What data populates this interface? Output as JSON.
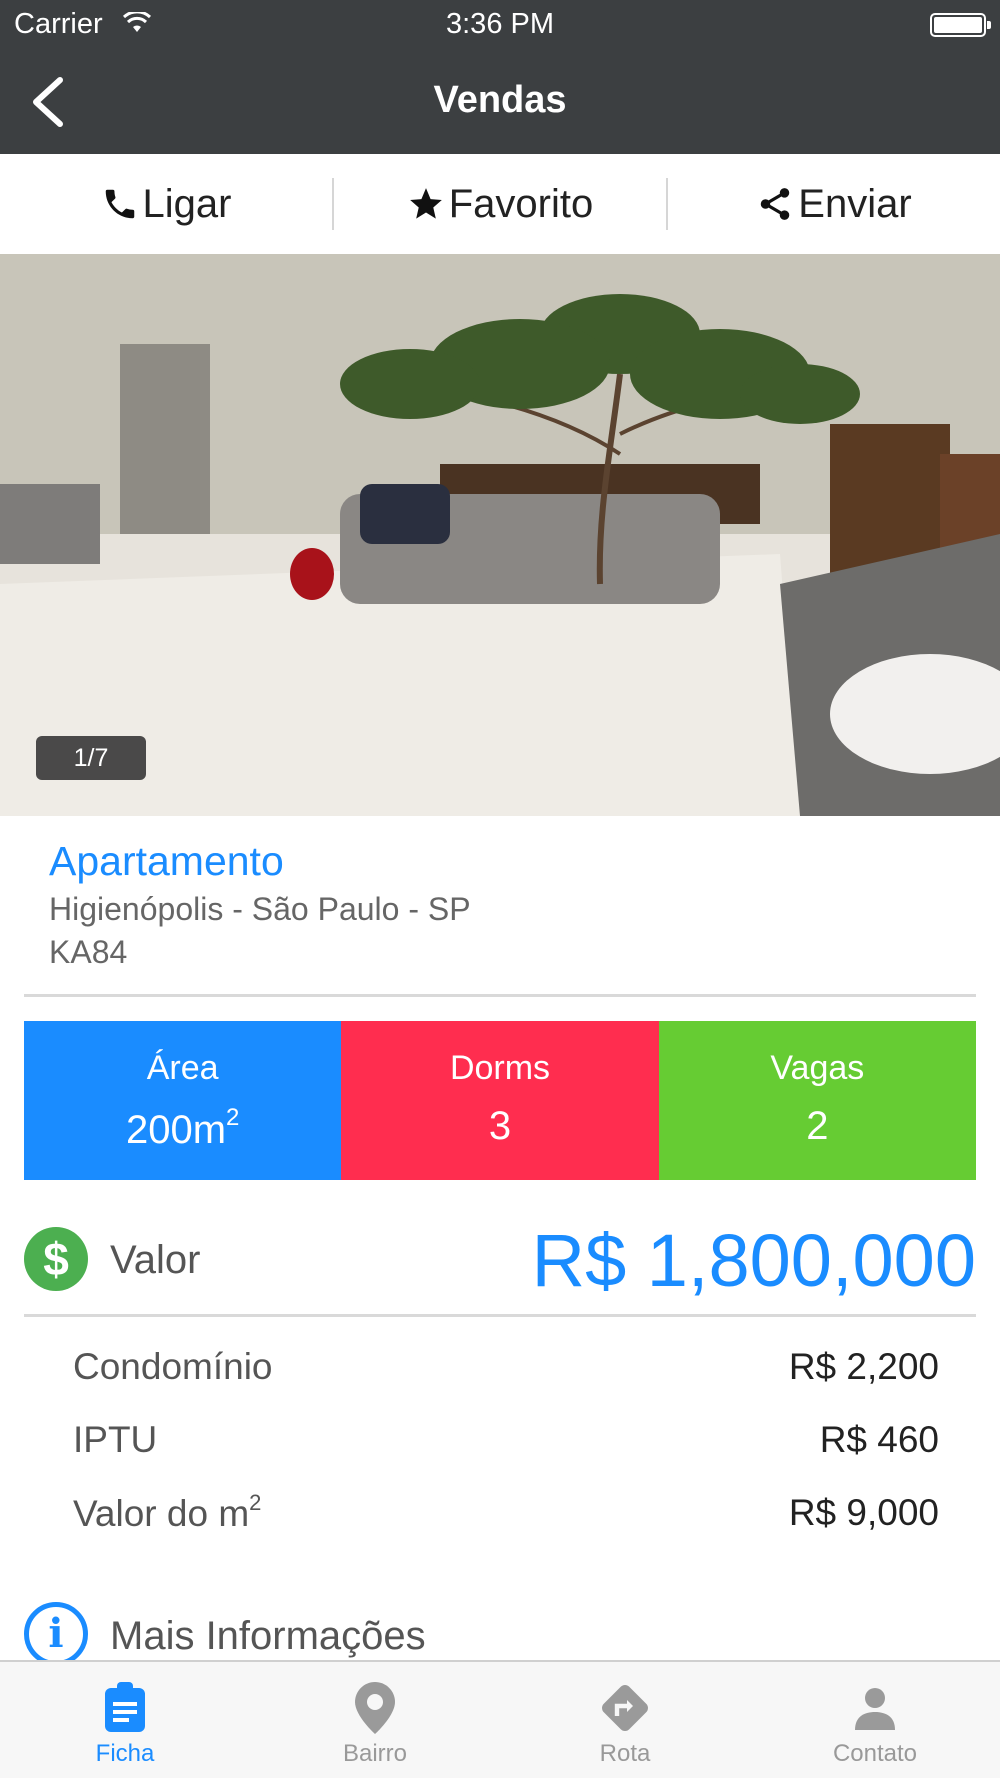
{
  "status_bar": {
    "carrier": "Carrier",
    "time": "3:36 PM"
  },
  "nav": {
    "title": "Vendas"
  },
  "actions": [
    {
      "label": "Ligar",
      "icon": "phone-icon"
    },
    {
      "label": "Favorito",
      "icon": "star-icon"
    },
    {
      "label": "Enviar",
      "icon": "share-icon"
    }
  ],
  "photo": {
    "counter": "1/7"
  },
  "property": {
    "type": "Apartamento",
    "location": "Higienópolis - São Paulo - SP",
    "code": "KA84"
  },
  "stats": [
    {
      "label": "Área",
      "value": "200m",
      "sup": "2",
      "color": "#1a8cff"
    },
    {
      "label": "Dorms",
      "value": "3",
      "color": "#ff2d4f"
    },
    {
      "label": "Vagas",
      "value": "2",
      "color": "#66cc33"
    }
  ],
  "valor": {
    "label": "Valor",
    "price": "R$ 1,800,000"
  },
  "costs": [
    {
      "label": "Condomínio",
      "value": "R$ 2,200"
    },
    {
      "label": "IPTU",
      "value": "R$ 460"
    },
    {
      "label": "Valor do m",
      "label_sup": "2",
      "value": "R$ 9,000"
    }
  ],
  "more_info": {
    "label": "Mais Informações"
  },
  "tabs": [
    {
      "label": "Ficha",
      "icon": "clipboard-icon",
      "active": true
    },
    {
      "label": "Bairro",
      "icon": "map-pin-icon",
      "active": false
    },
    {
      "label": "Rota",
      "icon": "route-icon",
      "active": false
    },
    {
      "label": "Contato",
      "icon": "person-icon",
      "active": false
    }
  ],
  "colors": {
    "accent": "#1a8cff",
    "bar": "#3c3f41",
    "valor_icon": "#4caf50"
  }
}
